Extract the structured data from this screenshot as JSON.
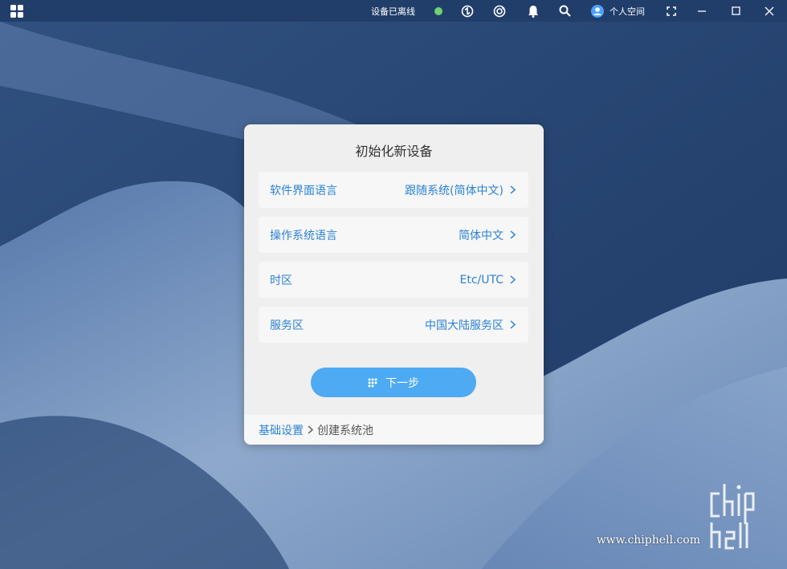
{
  "titlebar": {
    "status_text": "设备已离线",
    "user_label": "个人空间",
    "icons": [
      "apps-grid-icon",
      "status-dot",
      "sync-icon",
      "refresh-icon",
      "bell-icon",
      "search-icon",
      "user-icon",
      "fullscreen-icon",
      "minimize-icon",
      "maximize-icon",
      "close-icon"
    ],
    "status_color": "#6fd16f"
  },
  "dialog": {
    "title": "初始化新设备",
    "rows": [
      {
        "label": "软件界面语言",
        "value": "跟随系统(简体中文)"
      },
      {
        "label": "操作系统语言",
        "value": "简体中文"
      },
      {
        "label": "时区",
        "value": "Etc/UTC"
      },
      {
        "label": "服务区",
        "value": "中国大陆服务区"
      }
    ],
    "next_label": "下一步",
    "accent": "#2a82d6",
    "button_color": "#4eaaf2"
  },
  "breadcrumb": {
    "link": "基础设置",
    "current": "创建系统池"
  },
  "watermark": {
    "site": "www.chiphell.com",
    "logo_text": "chip hell"
  }
}
